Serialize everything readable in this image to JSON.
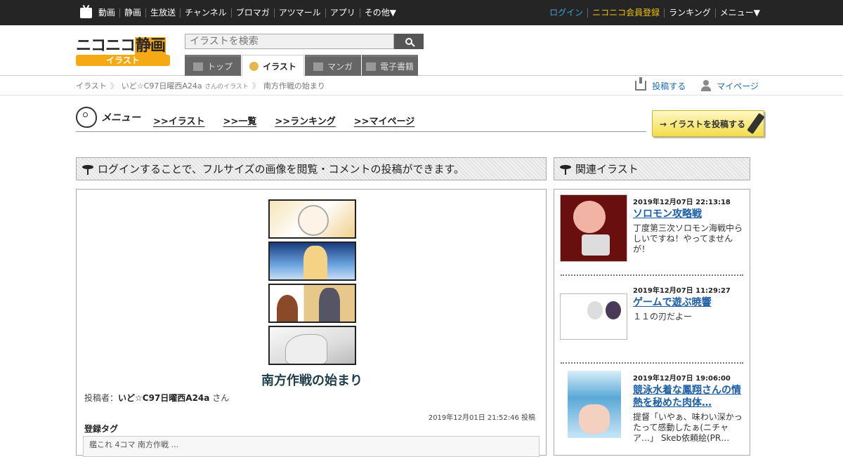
{
  "topbar": {
    "nav": [
      "動画",
      "静画",
      "生放送",
      "チャンネル",
      "ブロマガ",
      "アツマール",
      "アプリ",
      "その他▼"
    ],
    "login": "ログイン",
    "register": "ニコニコ会員登録",
    "ranking": "ランキング",
    "menu": "メニュー▼"
  },
  "header": {
    "logo_main": "ニコニコ",
    "logo_accent": "静画",
    "logo_sub": "イラスト",
    "search_placeholder": "イラストを検索",
    "tabs": [
      "トップ",
      "イラスト",
      "マンガ",
      "電子書籍"
    ]
  },
  "breadcrumb": {
    "root": "イラスト",
    "user": "いど☆C97日曜西A24a",
    "user_suffix": "さんのイラスト",
    "current": "南方作戦の始まり",
    "post": "投稿する",
    "mypage": "マイページ"
  },
  "menu": {
    "title": "メニュー",
    "links": [
      ">>イラスト",
      ">>一覧",
      ">>ランキング",
      ">>マイページ"
    ],
    "post_button": "→ イラストを投稿する"
  },
  "login_notice": "ログインすることで、フルサイズの画像を閲覧・コメントの投稿ができます。",
  "related_header": "関連イラスト",
  "illust": {
    "title": "南方作戦の始まり",
    "poster_label": "投稿者：",
    "poster_name": "いど☆C97日曜西A24a",
    "poster_suffix": "さん",
    "posted_at": "2019年12月01日 21:52:46 投稿",
    "tags_label": "登録タグ",
    "tags_text": "艦これ 4コマ 南方作戦 ..."
  },
  "related": [
    {
      "date": "2019年12月07日 22:13:18",
      "title": "ソロモン攻略戦",
      "desc": "丁度第三次ソロモン海戦中らしいですね！やってませんが！"
    },
    {
      "date": "2019年12月07日 11:29:27",
      "title": "ゲームで遊ぶ暁響",
      "desc": "１１の刃だよー"
    },
    {
      "date": "2019年12月07日 19:06:00",
      "title": "競泳水着な鳳翔さんの情熱を秘めた肉体…",
      "desc": "提督「いやぁ、味わい深かったって感動したぁ(ニチャア…」 Skeb依頼絵(PR…"
    }
  ]
}
